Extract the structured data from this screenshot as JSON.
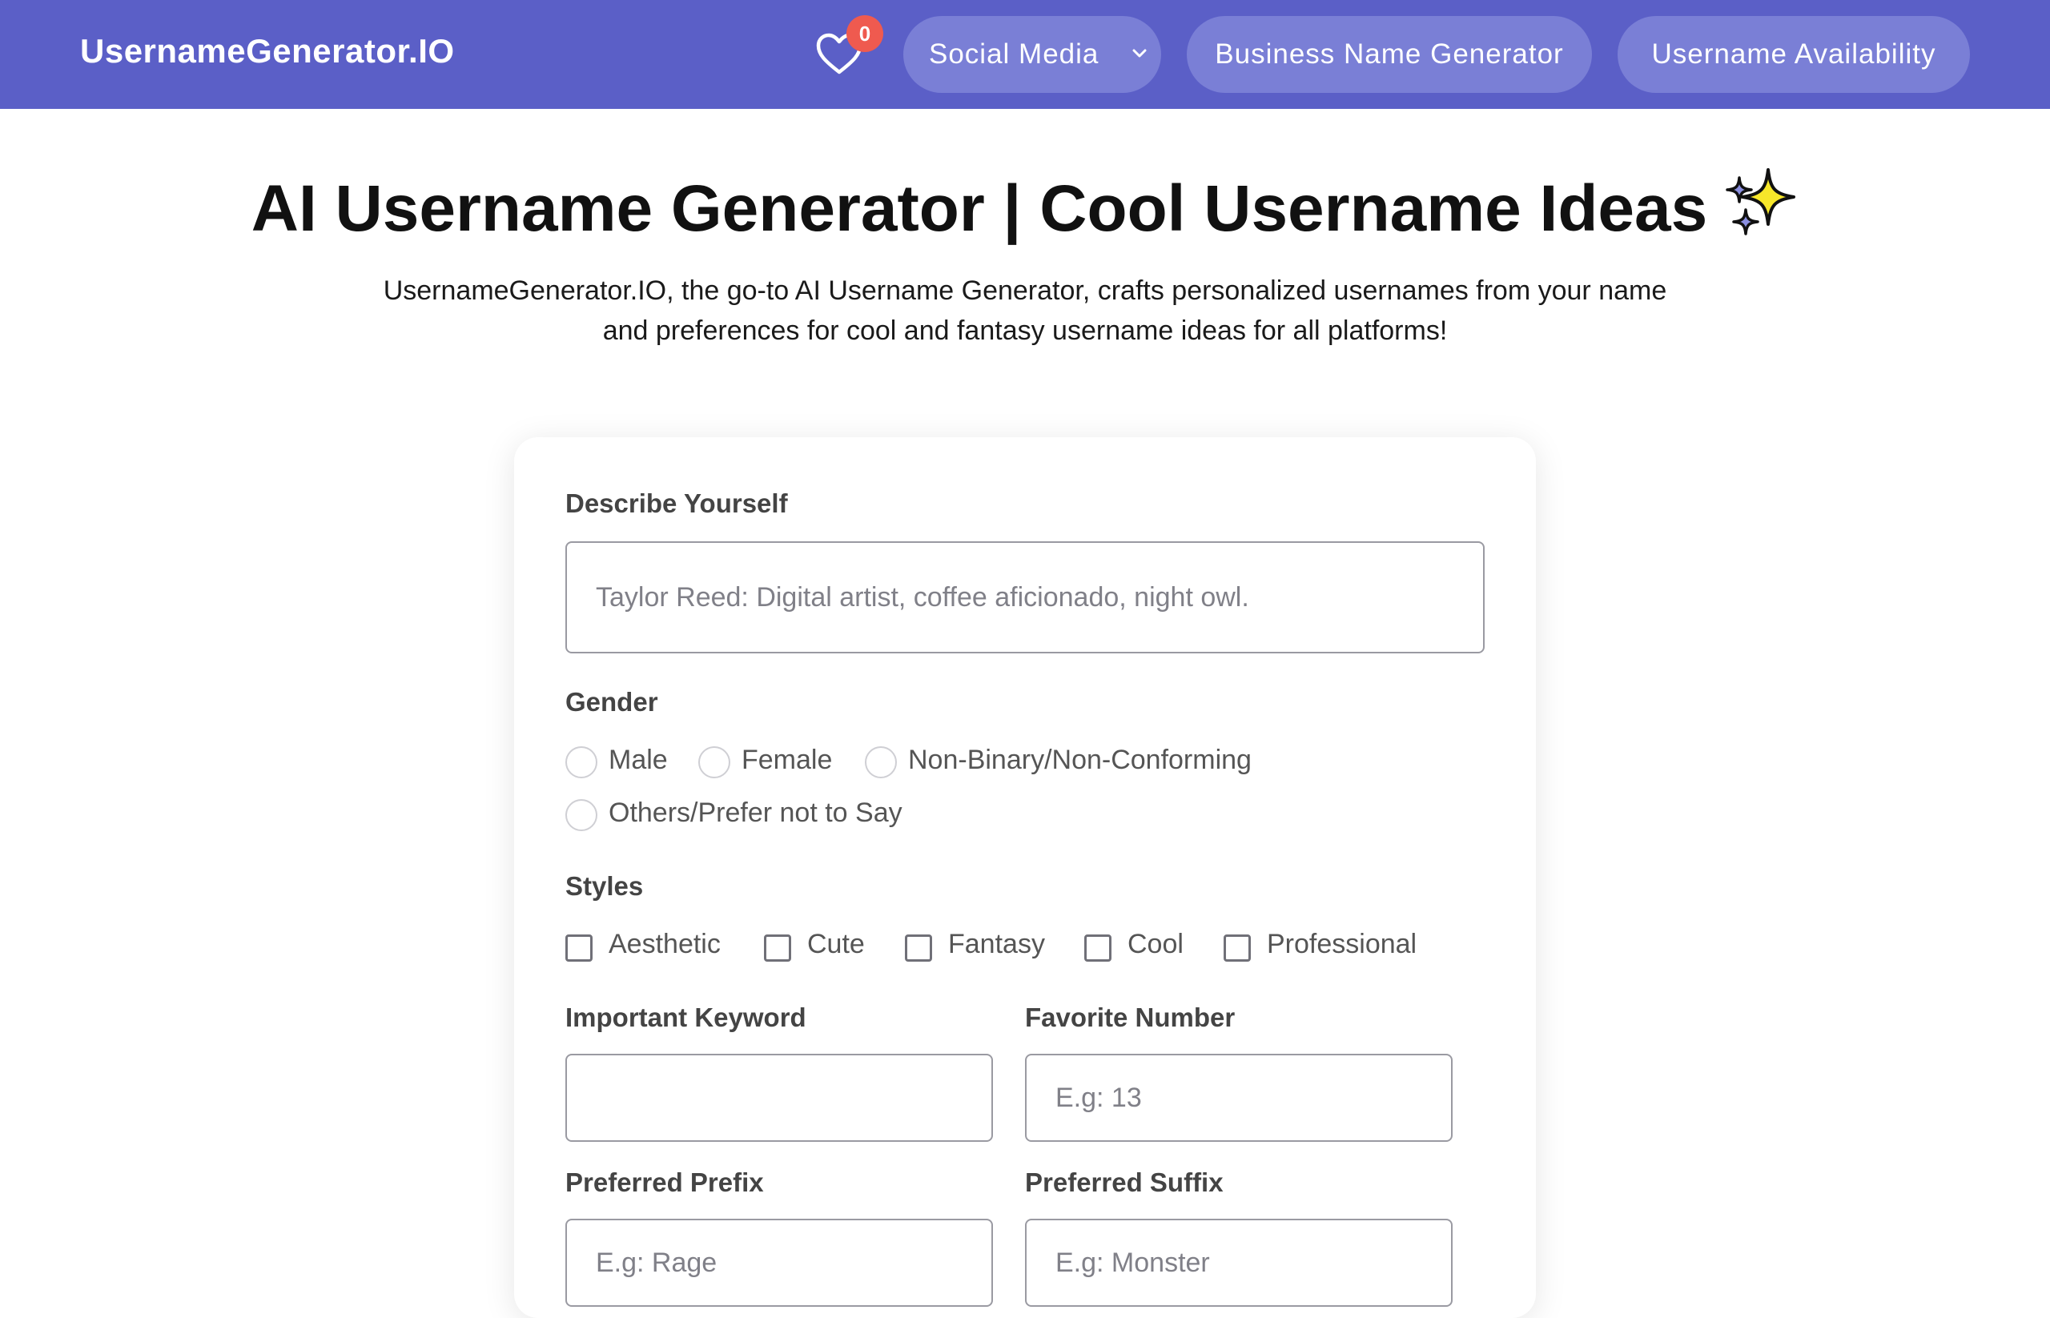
{
  "header": {
    "brand": "UsernameGenerator.IO",
    "favorites_count": "0",
    "nav": {
      "social_media": "Social Media",
      "business_name_generator": "Business Name Generator",
      "username_availability": "Username Availability"
    }
  },
  "hero": {
    "title": "AI Username Generator | Cool Username Ideas",
    "subtitle": "UsernameGenerator.IO, the go-to AI Username Generator, crafts personalized usernames from your name and preferences for cool and fantasy username ideas for all platforms!"
  },
  "form": {
    "describe": {
      "label": "Describe Yourself",
      "value": "",
      "placeholder": "Taylor Reed: Digital artist, coffee aficionado, night owl."
    },
    "gender": {
      "label": "Gender",
      "options": [
        "Male",
        "Female",
        "Non-Binary/Non-Conforming",
        "Others/Prefer not to Say"
      ]
    },
    "styles": {
      "label": "Styles",
      "options": [
        "Aesthetic",
        "Cute",
        "Fantasy",
        "Cool",
        "Professional"
      ]
    },
    "keyword": {
      "label": "Important Keyword",
      "value": "",
      "placeholder": ""
    },
    "number": {
      "label": "Favorite Number",
      "value": "",
      "placeholder": "E.g: 13"
    },
    "prefix": {
      "label": "Preferred Prefix",
      "value": "",
      "placeholder": "E.g: Rage"
    },
    "suffix": {
      "label": "Preferred Suffix",
      "value": "",
      "placeholder": "E.g: Monster"
    }
  },
  "colors": {
    "navbar": "#5b5fc7",
    "pill": "#7a7fd6",
    "badge": "#ef5a4f"
  }
}
